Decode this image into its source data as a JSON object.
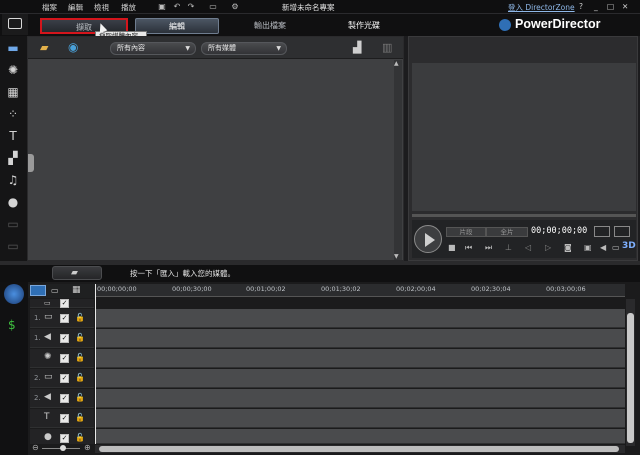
{
  "menu": {
    "items": [
      "檔案",
      "編輯",
      "檢視",
      "播放"
    ],
    "project_title": "新增未命名專案",
    "signin": "登入 DirectorZone",
    "win_controls": [
      "?",
      "_",
      "□",
      "✕"
    ]
  },
  "tabs": {
    "capture": "擷取",
    "edit": "編輯",
    "produce": "輸出檔案",
    "disc": "製作光碟",
    "tooltip": "擷取媒體內容"
  },
  "brand": {
    "name": "PowerDirector"
  },
  "library": {
    "filter_content": "所有內容",
    "filter_media": "所有媒體"
  },
  "preview": {
    "mode_clip": "片段",
    "mode_movie": "全片",
    "timecode": "00;00;00;00",
    "badge_3d": "3D"
  },
  "hint": {
    "text": "按一下「匯入」載入您的媒體。"
  },
  "ruler": {
    "ticks": [
      "00;00;00;00",
      "00;00;30;00",
      "00;01;00;02",
      "00;01;30;02",
      "00;02;00;04",
      "00;02;30;04",
      "00;03;00;06"
    ]
  },
  "tracks": {
    "n1": "1.",
    "n2": "1.",
    "n3": "2.",
    "n4": "2."
  },
  "colors": {
    "accent": "#2f6fb5",
    "highlight_border": "#d4151c"
  }
}
